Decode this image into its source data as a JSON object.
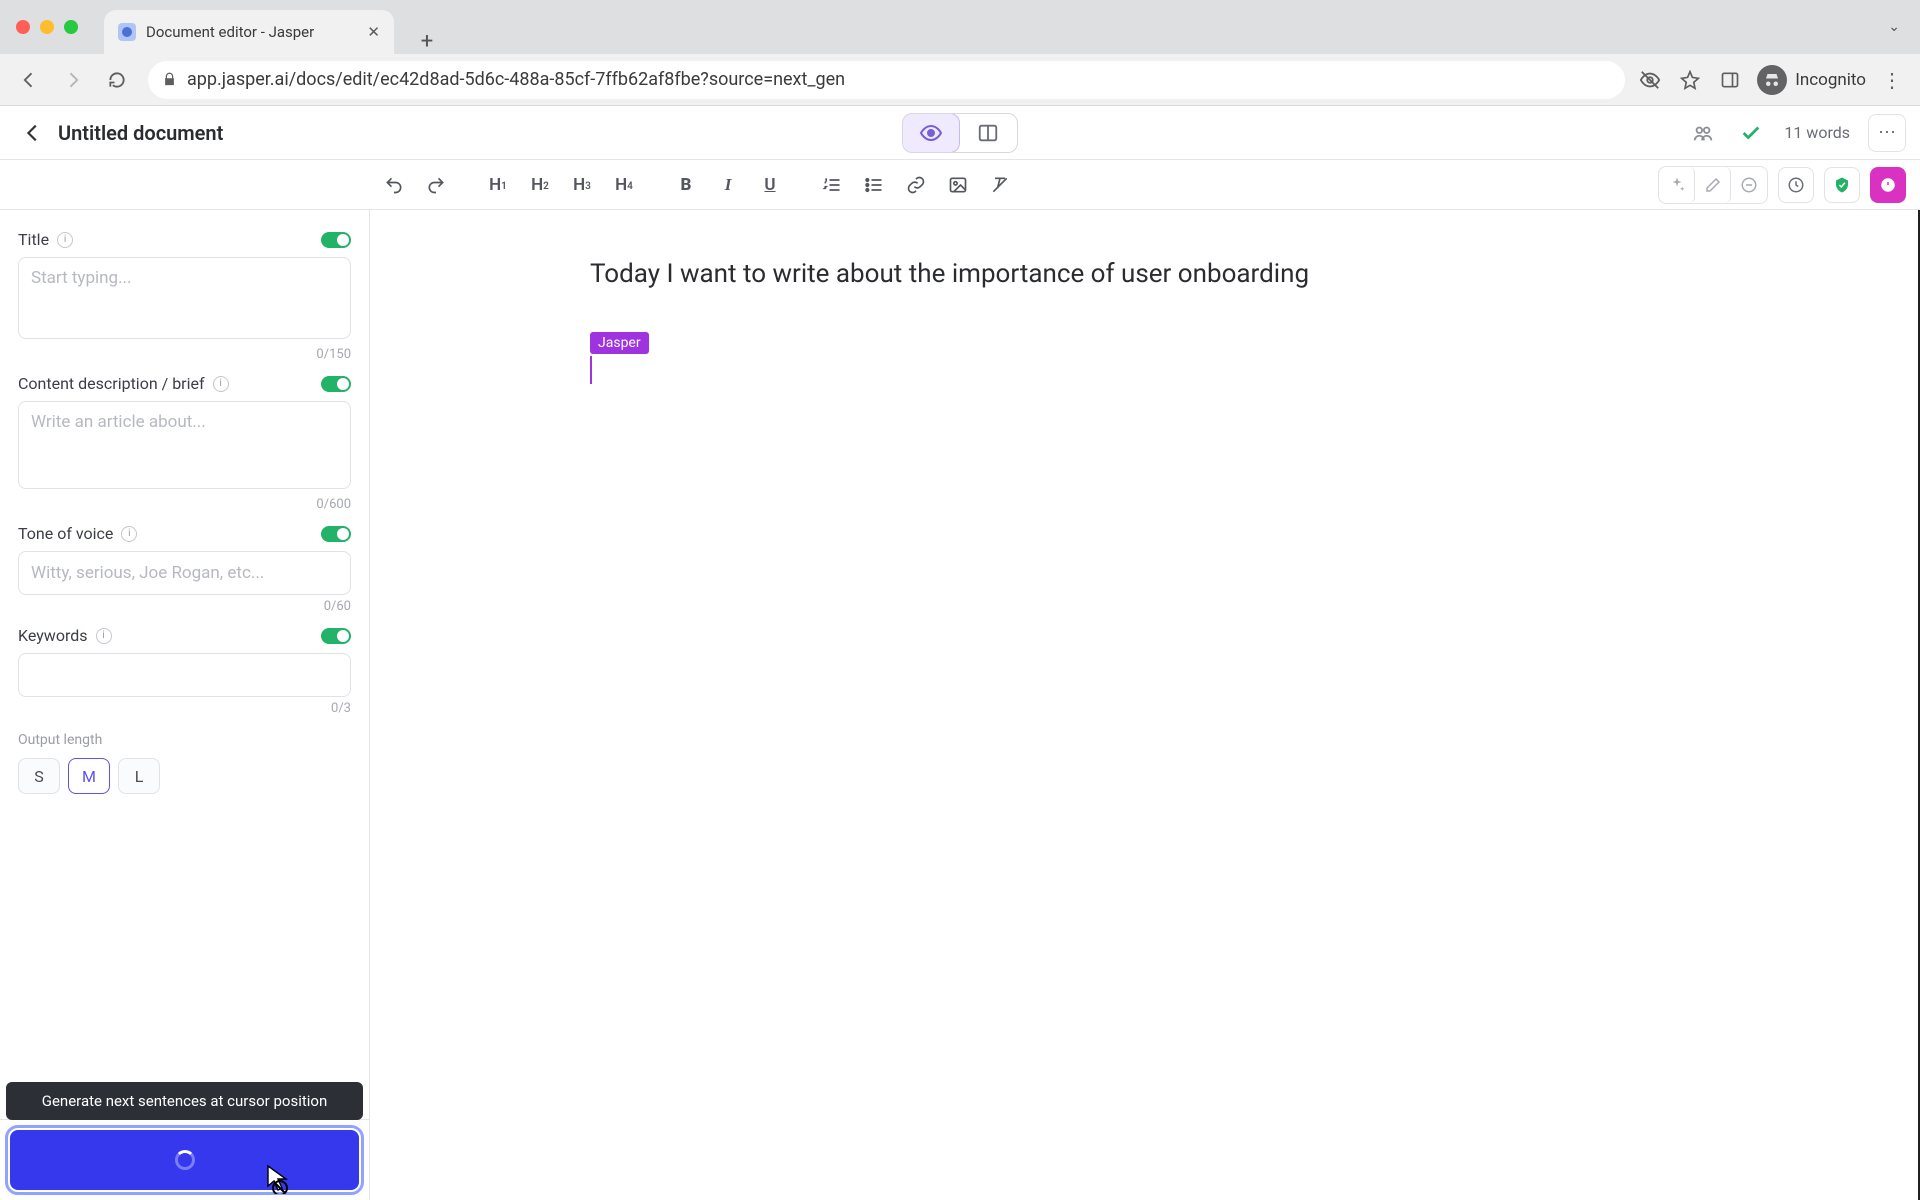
{
  "browser": {
    "tab_title": "Document editor - Jasper",
    "url": "app.jasper.ai/docs/edit/ec42d8ad-5d6c-488a-85cf-7ffb62af8fbe?source=next_gen",
    "incognito_label": "Incognito"
  },
  "appbar": {
    "doc_title": "Untitled document",
    "word_count": "11 words"
  },
  "sidebar": {
    "title": {
      "label": "Title",
      "placeholder": "Start typing...",
      "counter": "0/150"
    },
    "brief": {
      "label": "Content description / brief",
      "placeholder": "Write an article about...",
      "counter": "0/600"
    },
    "tone": {
      "label": "Tone of voice",
      "placeholder": "Witty, serious, Joe Rogan, etc...",
      "counter": "0/60"
    },
    "keywords": {
      "label": "Keywords",
      "counter": "0/3"
    },
    "output_length": {
      "label": "Output length",
      "s": "S",
      "m": "M",
      "l": "L"
    },
    "tooltip": "Generate next sentences at cursor position"
  },
  "editor": {
    "content": "Today I want to write about the importance of user onboarding",
    "tag": "Jasper"
  },
  "toolbar": {
    "h1": "H",
    "h1s": "1",
    "h2": "H",
    "h2s": "2",
    "h3": "H",
    "h3s": "3",
    "h4": "H",
    "h4s": "4",
    "bold": "B",
    "italic": "I",
    "underline": "U"
  }
}
